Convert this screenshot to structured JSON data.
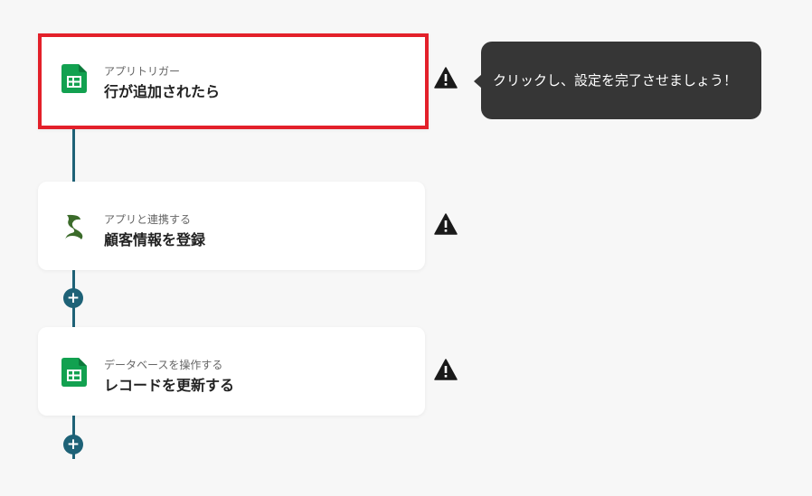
{
  "flow": {
    "steps": [
      {
        "icon": "google-sheets-icon",
        "subtitle": "アプリトリガー",
        "title": "行が追加されたら",
        "selected": true
      },
      {
        "icon": "sansan-icon",
        "subtitle": "アプリと連携する",
        "title": "顧客情報を登録",
        "selected": false
      },
      {
        "icon": "google-sheets-icon",
        "subtitle": "データベースを操作する",
        "title": "レコードを更新する",
        "selected": false
      }
    ],
    "add_label": "+"
  },
  "tooltip": {
    "text": "クリックし、設定を完了させましょう！"
  },
  "colors": {
    "connector": "#1e6277",
    "highlight": "#e3202a",
    "sheets_green": "#12a150",
    "warning": "#1a1a1a"
  }
}
